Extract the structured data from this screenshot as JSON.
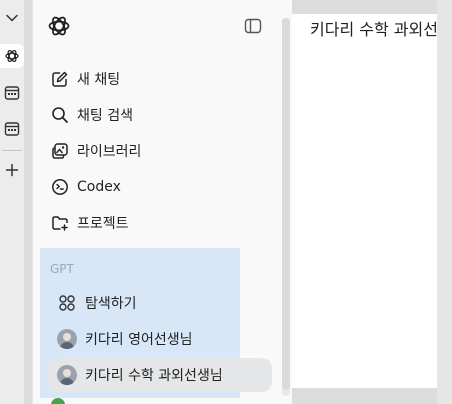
{
  "sidebar": {
    "nav": [
      {
        "label": "새 채팅",
        "icon": "new-chat-icon"
      },
      {
        "label": "채팅 검색",
        "icon": "search-icon"
      },
      {
        "label": "라이브러리",
        "icon": "library-icon"
      },
      {
        "label": "Codex",
        "icon": "codex-icon"
      },
      {
        "label": "프로젝트",
        "icon": "new-project-icon"
      }
    ],
    "gpt_heading": "GPT",
    "gpts": [
      {
        "label": "탐색하기",
        "icon": "explore-grid-icon"
      },
      {
        "label": "키다리 영어선생님",
        "icon": "avatar"
      },
      {
        "label": "키다리 수학 과외선생님",
        "icon": "avatar"
      }
    ]
  },
  "main": {
    "title": "키다리 수학 과외선생님"
  }
}
